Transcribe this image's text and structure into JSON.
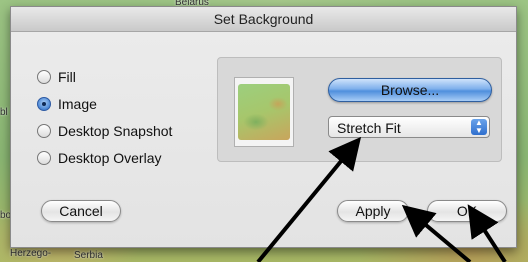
{
  "background": {
    "labels": {
      "top": "Belarus",
      "left_mid": "bl",
      "left_low": "bo",
      "bottom_left": "Herzego-",
      "bottom_mid": "Serbia"
    }
  },
  "dialog": {
    "title": "Set Background",
    "options": [
      {
        "label": "Fill",
        "selected": false
      },
      {
        "label": "Image",
        "selected": true
      },
      {
        "label": "Desktop Snapshot",
        "selected": false
      },
      {
        "label": "Desktop Overlay",
        "selected": false
      }
    ],
    "browse_label": "Browse...",
    "fit_select": {
      "value": "Stretch Fit"
    },
    "cancel_label": "Cancel",
    "apply_label": "Apply",
    "ok_label": "OK"
  },
  "colors": {
    "accent_blue": "#4f8fdd",
    "arrow": "#000000"
  }
}
